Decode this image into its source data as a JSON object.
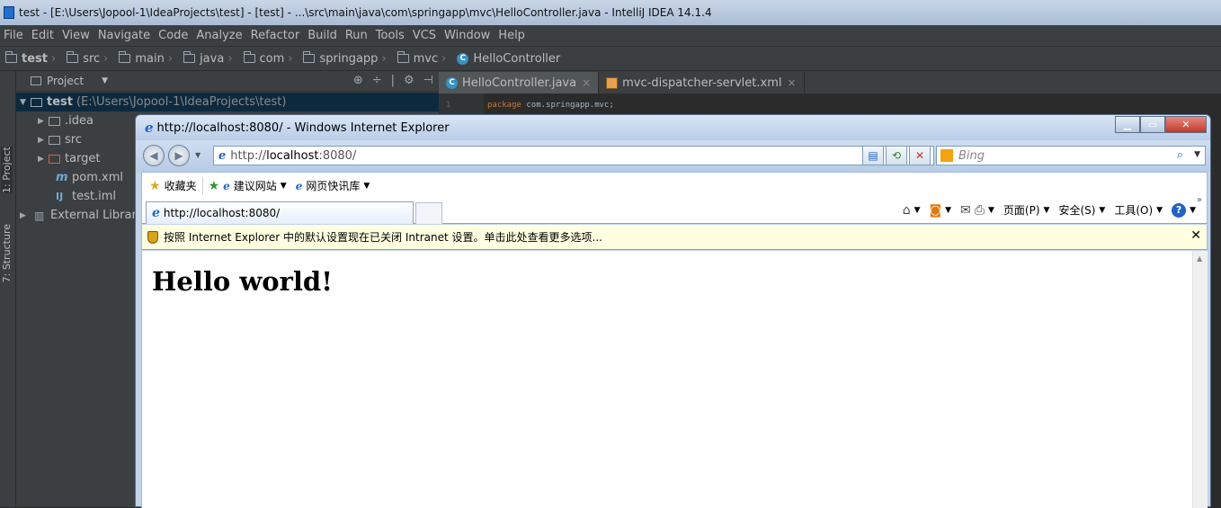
{
  "ide": {
    "title": "test - [E:\\Users\\Jopool-1\\IdeaProjects\\test] - [test] - ...\\src\\main\\java\\com\\springapp\\mvc\\HelloController.java - IntelliJ IDEA 14.1.4",
    "menu": [
      "File",
      "Edit",
      "View",
      "Navigate",
      "Code",
      "Analyze",
      "Refactor",
      "Build",
      "Run",
      "Tools",
      "VCS",
      "Window",
      "Help"
    ],
    "breadcrumbs": [
      "test",
      "src",
      "main",
      "java",
      "com",
      "springapp",
      "mvc",
      "HelloController"
    ],
    "side_tabs": {
      "project": "1: Project",
      "structure": "7: Structure"
    },
    "project_panel": {
      "title": "Project",
      "tree": [
        {
          "label": "test",
          "path": "(E:\\Users\\Jopool-1\\IdeaProjects\\test)"
        },
        {
          "label": ".idea"
        },
        {
          "label": "src"
        },
        {
          "label": "target"
        },
        {
          "label": "pom.xml"
        },
        {
          "label": "test.iml"
        },
        {
          "label": "External Librari"
        }
      ]
    },
    "editor_tabs": [
      {
        "label": "HelloController.java",
        "close": "×"
      },
      {
        "label": "mvc-dispatcher-servlet.xml",
        "close": "×"
      }
    ],
    "code": {
      "line_no": "1",
      "keyword": "package",
      "rest": " com.springapp.mvc;"
    }
  },
  "ie": {
    "title": "http://localhost:8080/ - Windows Internet Explorer",
    "address": {
      "dim": "http://",
      "host": "localhost",
      "port": ":8080/"
    },
    "search_placeholder": "Bing",
    "favorites_label": "收藏夹",
    "fav_links": [
      "建议网站",
      "网页快讯库"
    ],
    "tab_label": "http://localhost:8080/",
    "command_bar": {
      "page": "页面(P)",
      "safety": "安全(S)",
      "tools": "工具(O)"
    },
    "info_bar": "按照 Internet Explorer 中的默认设置现在已关闭 Intranet 设置。单击此处查看更多选项...",
    "page_heading": "Hello world!"
  }
}
